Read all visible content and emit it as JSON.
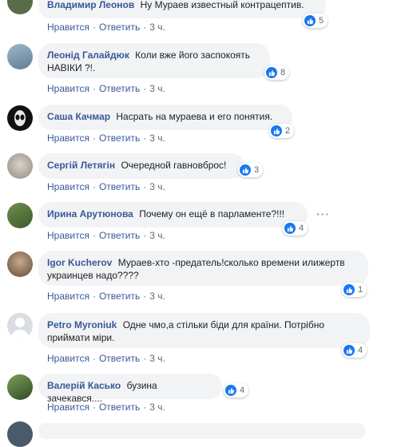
{
  "comments": [
    {
      "author": "Владимир Леонов",
      "text": "Ну Мураев известный контрацептив.",
      "likes": "5",
      "like_label": "Нравится",
      "reply_label": "Ответить",
      "time": "3 ч."
    },
    {
      "author": "Леонід Галайдюк",
      "text": "Коли вже його заспокоять НАВІКИ ?!.",
      "likes": "8",
      "like_label": "Нравится",
      "reply_label": "Ответить",
      "time": "3 ч."
    },
    {
      "author": "Саша Качмар",
      "text": "Насрать на мураева и его понятия.",
      "likes": "2",
      "like_label": "Нравится",
      "reply_label": "Ответить",
      "time": "3 ч."
    },
    {
      "author": "Сергій Летягін",
      "text": "Очередной гавновброс!",
      "likes": "3",
      "like_label": "Нравится",
      "reply_label": "Ответить",
      "time": "3 ч."
    },
    {
      "author": "Ирина Арутюнова",
      "text": "Почему он ещё в парламенте?!!!",
      "likes": "4",
      "like_label": "Нравится",
      "reply_label": "Ответить",
      "time": "3 ч."
    },
    {
      "author": "Igor Kucherov",
      "text": "Мураев-хто -предатель!сколько времени илижертв украинцев надо????",
      "likes": "1",
      "like_label": "Нравится",
      "reply_label": "Ответить",
      "time": "3 ч."
    },
    {
      "author": "Petro Myroniuk",
      "text": "Одне чмо,а стільки біди для країни. Потрібно приймати міри.",
      "likes": "4",
      "like_label": "Нравится",
      "reply_label": "Ответить",
      "time": "3 ч."
    },
    {
      "author": "Валерій Касько",
      "text": "бузина зачекався....",
      "likes": "4",
      "like_label": "Нравится",
      "reply_label": "Ответить",
      "time": "3 ч."
    }
  ],
  "more_icon": "ellipsis-icon",
  "like_icon": "thumbs-up-icon",
  "colors": {
    "author": "#385898",
    "bubble": "#f2f3f5",
    "like": "#1877f2",
    "meta": "#606770"
  }
}
